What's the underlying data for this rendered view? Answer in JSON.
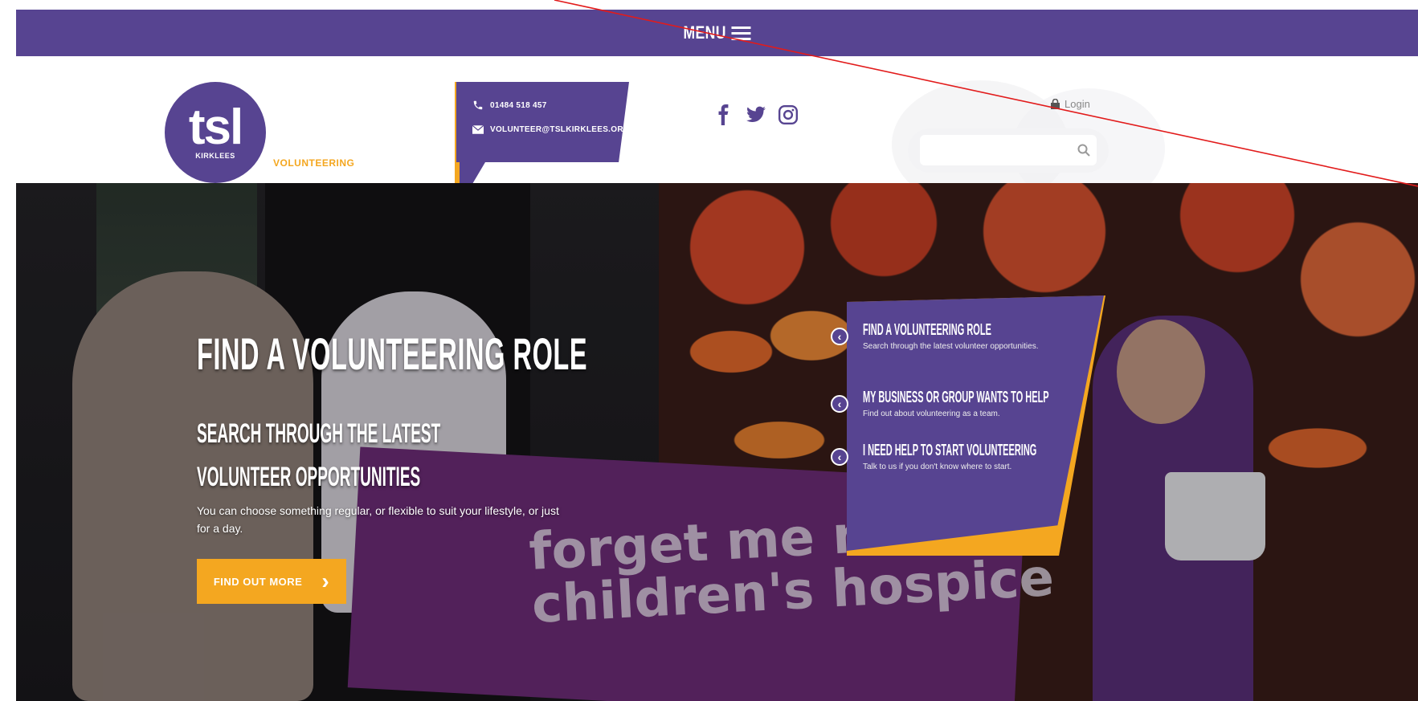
{
  "nav": {
    "menu_label": "MENU"
  },
  "brand": {
    "logo_text": "tsl",
    "logo_sub": "KIRKLEES",
    "tagline": "VOLUNTEERING",
    "color_primary": "#574491",
    "color_accent": "#f4a720"
  },
  "contact": {
    "phone": "01484 518 457",
    "email": "VOLUNTEER@TSLKIRKLEES.ORG.UK"
  },
  "social": {
    "icons": [
      "facebook-icon",
      "twitter-icon",
      "instagram-icon"
    ]
  },
  "account": {
    "login_label": "Login"
  },
  "search": {
    "placeholder": ""
  },
  "hero": {
    "title": "FIND A VOLUNTEERING ROLE",
    "subtitle": "SEARCH THROUGH THE LATEST VOLUNTEER OPPORTUNITIES",
    "description": "You can choose something regular, or flexible to suit your lifestyle, or just for a day.",
    "cta_label": "FIND OUT MORE",
    "banner_text_line1": "forget me n",
    "banner_text_line2": "children's hospice"
  },
  "panel": {
    "items": [
      {
        "title": "FIND A VOLUNTEERING ROLE",
        "desc": "Search through the latest volunteer opportunities."
      },
      {
        "title": "MY BUSINESS OR GROUP WANTS TO HELP",
        "desc": "Find out about volunteering as a team."
      },
      {
        "title": "I NEED HELP TO START VOLUNTEERING",
        "desc": "Talk to us if you don't know where to start."
      }
    ]
  }
}
